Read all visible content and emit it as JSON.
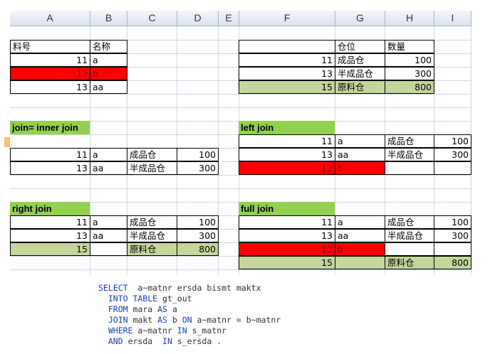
{
  "columns": [
    "A",
    "B",
    "C",
    "D",
    "E",
    "F",
    "G",
    "H",
    "I"
  ],
  "table_mara": {
    "headers": [
      "料号",
      "名称"
    ],
    "rows": [
      {
        "key": "11",
        "name": "a"
      },
      {
        "key": "12",
        "name": "b"
      },
      {
        "key": "13",
        "name": "aa"
      }
    ]
  },
  "table_makt": {
    "headers": [
      "",
      "仓位",
      "数量"
    ],
    "rows": [
      {
        "key": "11",
        "loc": "成品仓",
        "qty": "100"
      },
      {
        "key": "13",
        "loc": "半成品仓",
        "qty": "300"
      },
      {
        "key": "15",
        "loc": "原料仓",
        "qty": "800"
      }
    ]
  },
  "inner_join": {
    "label": "join= inner join",
    "rows": [
      {
        "key": "11",
        "name": "a",
        "loc": "成品仓",
        "qty": "100"
      },
      {
        "key": "13",
        "name": "aa",
        "loc": "半成品仓",
        "qty": "300"
      }
    ]
  },
  "left_join": {
    "label": "left join",
    "rows": [
      {
        "key": "11",
        "name": "a",
        "loc": "成品仓",
        "qty": "100"
      },
      {
        "key": "13",
        "name": "aa",
        "loc": "半成品仓",
        "qty": "300"
      },
      {
        "key": "12",
        "name": "b",
        "loc": "",
        "qty": ""
      }
    ]
  },
  "right_join": {
    "label": "right join",
    "rows": [
      {
        "key": "11",
        "name": "a",
        "loc": "成品仓",
        "qty": "100"
      },
      {
        "key": "13",
        "name": "aa",
        "loc": "半成品仓",
        "qty": "300"
      },
      {
        "key": "15",
        "name": "",
        "loc": "原料仓",
        "qty": "800"
      }
    ]
  },
  "full_join": {
    "label": "full join",
    "rows": [
      {
        "key": "11",
        "name": "a",
        "loc": "成品仓",
        "qty": "100"
      },
      {
        "key": "13",
        "name": "aa",
        "loc": "半成品仓",
        "qty": "300"
      },
      {
        "key": "12",
        "name": "b",
        "loc": "",
        "qty": ""
      },
      {
        "key": "15",
        "name": "",
        "loc": "原料仓",
        "qty": "800"
      }
    ]
  },
  "sql": {
    "select_kw": "SELECT",
    "select_rest": "  a~matnr ersda bismt maktx",
    "into_kw": "INTO TABLE",
    "into_rest": " gt_out",
    "from_kw": "FROM",
    "from_a": " mara ",
    "as_kw": "AS",
    "from_b": " a",
    "join_kw": "JOIN",
    "join_a": " makt ",
    "join_as": "AS",
    "join_b": " b ",
    "on_kw": "ON",
    "join_c": " a~matnr = b~matnr",
    "where_kw": "WHERE",
    "where_a": " a~matnr ",
    "in_kw": "IN",
    "where_b": " s_matnr",
    "and_kw": "AND",
    "and_a": " ersda  ",
    "in2_kw": "IN",
    "and_b": " s_ersda ."
  },
  "colors": {
    "highlight_red": "#ff0000",
    "label_green": "#92d050",
    "row_green": "#c4d79b",
    "keyword_blue": "#1a3fb0"
  }
}
